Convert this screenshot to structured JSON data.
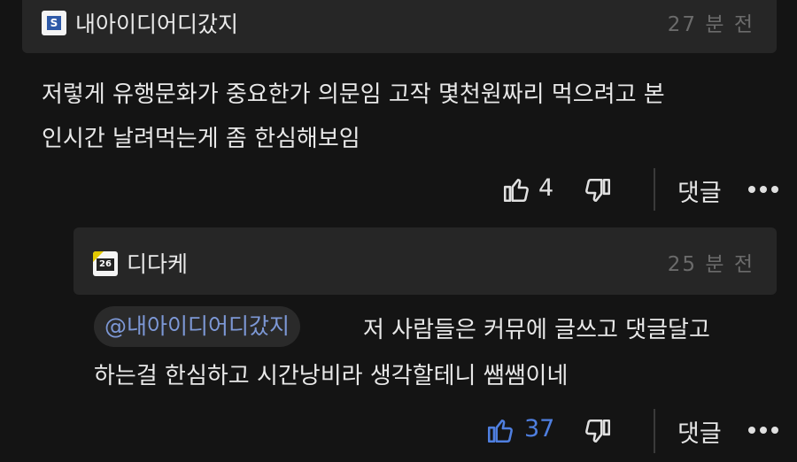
{
  "comment": {
    "username": "내아이디어디갔지",
    "avatar_text": "S",
    "time": "27 분 전",
    "lines": [
      "저렇게 유행문화가 중요한가 의문임 고작 몇천원짜리 먹으려고 본",
      "인시간 날려먹는게 좀 한심해보임"
    ],
    "like_count": "4",
    "reply_label": "댓글"
  },
  "reply": {
    "username": "디다케",
    "avatar_text": "26",
    "time": "25 분 전",
    "mention": "@내아이디어디갔지",
    "line1": "저 사람들은 커뮤에 글쓰고 댓글달고",
    "line2": "하는걸 한심하고 시간낭비라 생각할테니 쌤쌤이네",
    "like_count": "37",
    "reply_label": "댓글"
  },
  "colors": {
    "background": "#141414",
    "header_bg": "#262626",
    "mention_text": "#7d98d6",
    "liked_blue": "#4f7fe0",
    "timestamp": "#6b6b6b"
  },
  "icons": {
    "like": "thumbs-up-icon",
    "dislike": "thumbs-down-icon",
    "more": "more-dots-icon"
  }
}
